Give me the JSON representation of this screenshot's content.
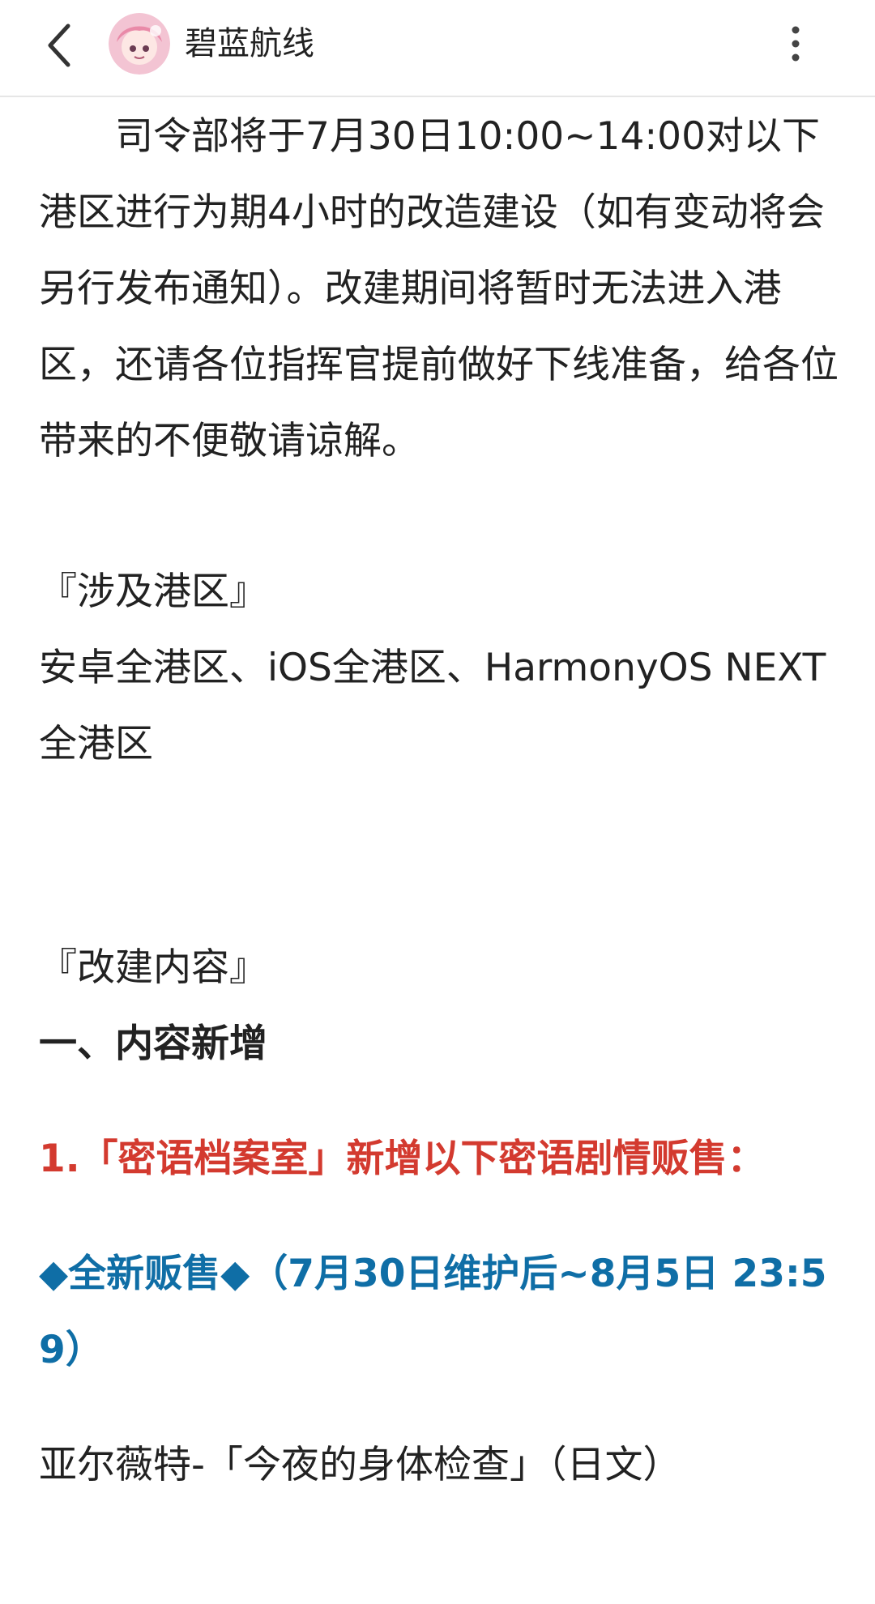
{
  "header": {
    "back_icon": "chevron-left-icon",
    "title": "碧蓝航线",
    "more_icon": "more-vertical-icon"
  },
  "article": {
    "intro": "　　司令部将于7月30日10:00~14:00对以下港区进行为期4小时的改造建设（如有变动将会另行发布通知）。改建期间将暂时无法进入港区，还请各位指挥官提前做好下线准备，给各位带来的不便敬请谅解。",
    "section1_title": "『涉及港区』",
    "section1_body": "安卓全港区、iOS全港区、HarmonyOS NEXT全港区",
    "section2_title": "『改建内容』",
    "heading_new": "一、内容新增",
    "item1": "1.「密语档案室」新增以下密语剧情贩售：",
    "sale_line": "◆全新贩售◆（7月30日维护后~8月5日 23:59）",
    "story_line": "亚尔薇特-「今夜的身体检查」（日文）"
  },
  "colors": {
    "red_heading": "#d33a2f",
    "blue_heading": "#0f6ea6",
    "text": "#222222"
  }
}
